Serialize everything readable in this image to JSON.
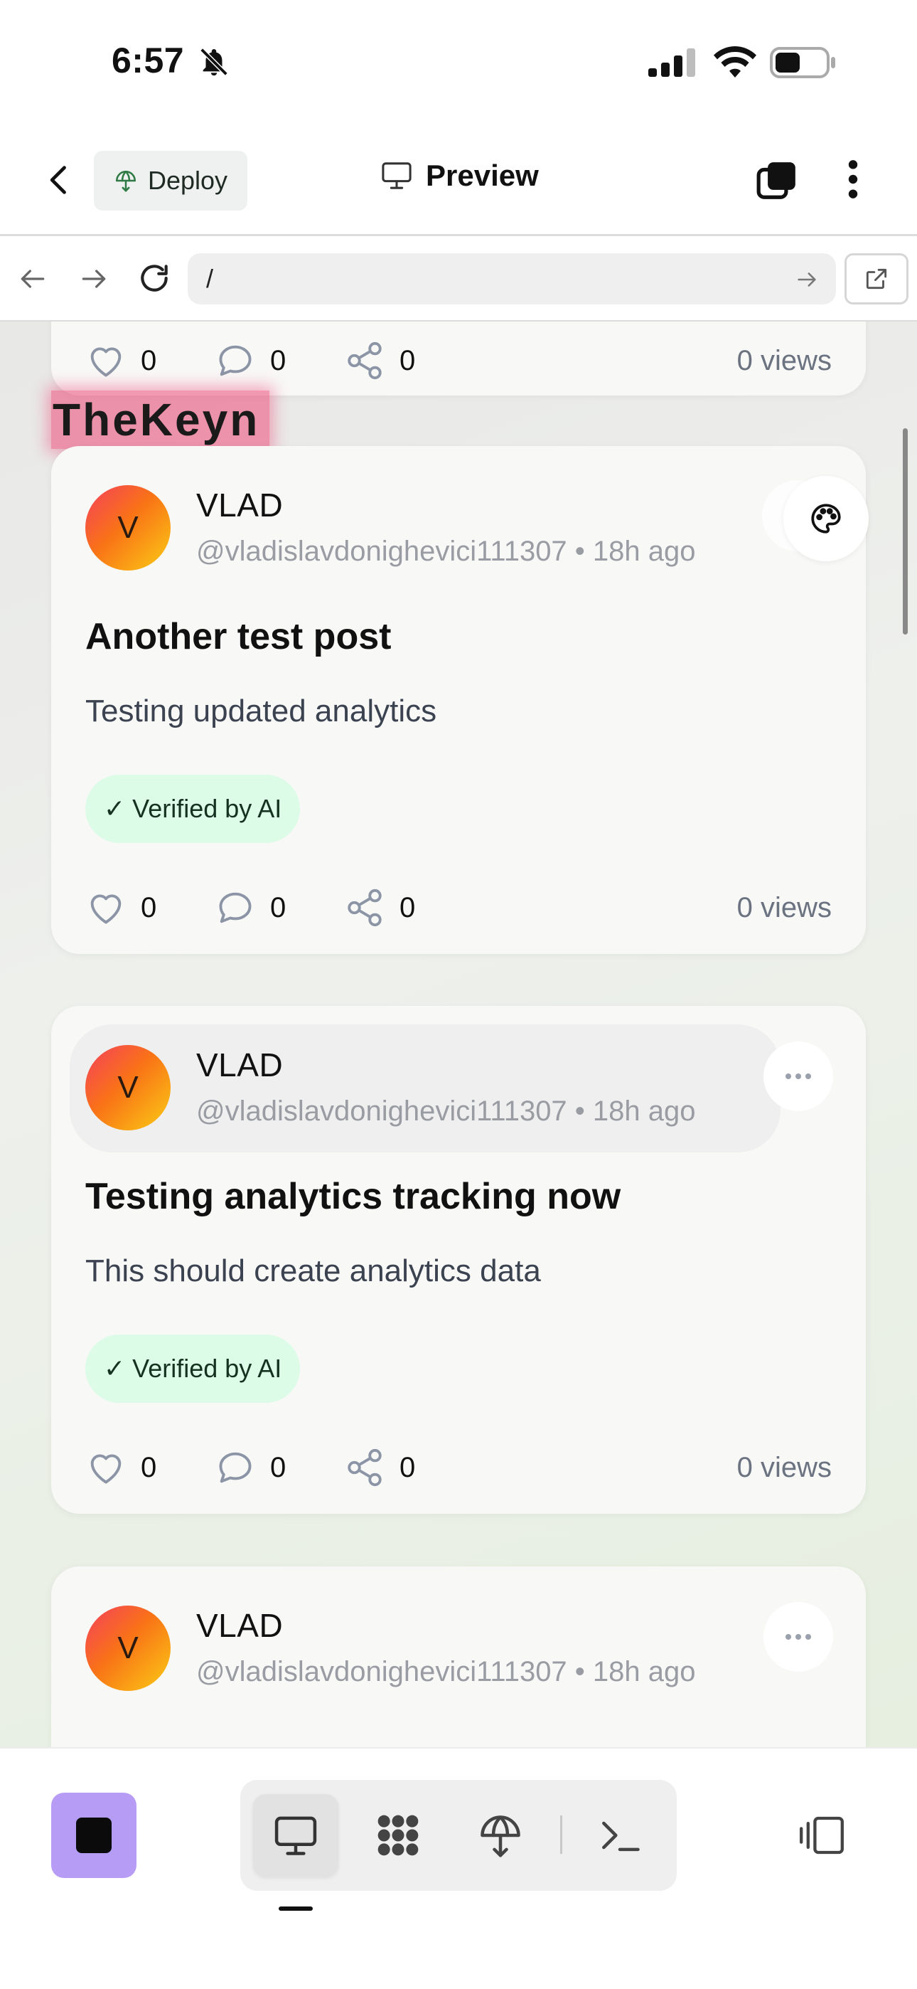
{
  "status_bar": {
    "time": "6:57"
  },
  "header": {
    "back_label": "",
    "deploy_label": "Deploy",
    "title": "Preview"
  },
  "browser": {
    "url": "/"
  },
  "brand_tag": "TheKeyn",
  "posts": [
    {
      "author": "",
      "handle": "",
      "title": "",
      "body": "",
      "likes": "0",
      "comments": "0",
      "shares": "0",
      "views": "0 views"
    },
    {
      "author": "VLAD",
      "avatar_letter": "V",
      "handle": "@vladislavdonighevici111307 • 18h ago",
      "title": "Another test post",
      "body": "Testing updated analytics",
      "badge": "✓ Verified by AI",
      "likes": "0",
      "comments": "0",
      "shares": "0",
      "views": "0 views"
    },
    {
      "author": "VLAD",
      "avatar_letter": "V",
      "handle": "@vladislavdonighevici111307 • 18h ago",
      "title": "Testing analytics tracking now",
      "body": "This should create analytics data",
      "badge": "✓ Verified by AI",
      "likes": "0",
      "comments": "0",
      "shares": "0",
      "views": "0 views"
    },
    {
      "author": "VLAD",
      "avatar_letter": "V",
      "handle": "@vladislavdonighevici111307 • 18h ago"
    }
  ],
  "toolbar": {
    "modes": [
      "monitor-icon",
      "apps-grid-icon",
      "deploy-icon",
      "terminal-icon"
    ],
    "active_mode": "monitor-icon"
  },
  "colors": {
    "accent_purple": "#b69cf5",
    "verified_bg": "#dcfce7",
    "brand_highlight": "#ec4878",
    "avatar_gradient": [
      "#f43f5e",
      "#f97316",
      "#facc15"
    ]
  }
}
